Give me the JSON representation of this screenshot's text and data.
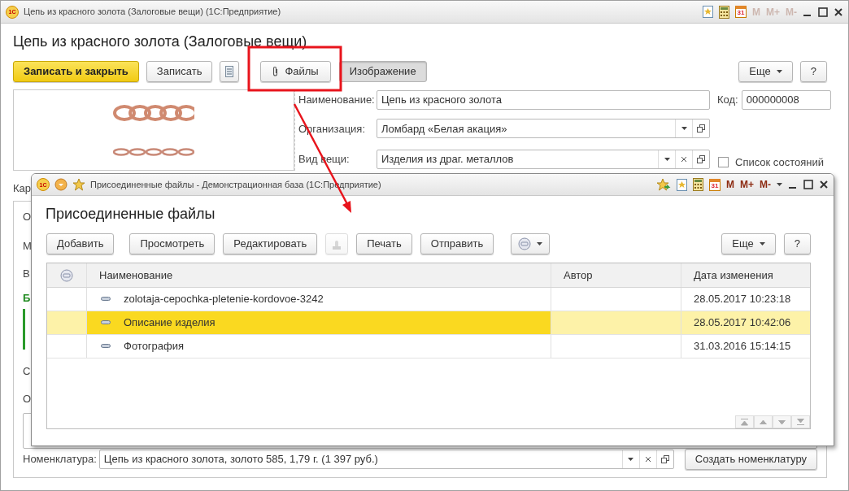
{
  "main_window": {
    "logo": "1С",
    "title": "Цепь из красного золота (Залоговые вещи)  (1С:Предприятие)",
    "titlebar_tools": {
      "calendar_day": "31",
      "memory_buttons": [
        "M",
        "M+",
        "M-"
      ],
      "memory_disabled": true
    },
    "form_title": "Цепь из красного золота (Залоговые вещи)",
    "toolbar": [
      {
        "kind": "primary",
        "label": "Записать и закрыть"
      },
      {
        "kind": "button",
        "label": "Записать"
      },
      {
        "kind": "list_icon"
      },
      {
        "kind": "attach",
        "label": "Файлы"
      },
      {
        "kind": "toggle",
        "label": "Изображение",
        "pressed": true
      }
    ],
    "more": "Еще",
    "help": "?",
    "fields": [
      {
        "kind": "text",
        "label": "Наименование:",
        "value": "Цепь из красного золота"
      },
      {
        "kind": "select",
        "label": "Организация:",
        "value": "Ломбард «Белая акация»"
      },
      {
        "kind": "select_clear",
        "label": "Вид вещи:",
        "value": "Изделия из драг. металлов"
      }
    ],
    "code": {
      "label": "Код:",
      "value": "000000008"
    },
    "checkbox": {
      "label": "Список состояний",
      "checked": false
    },
    "card_label": "Кар",
    "panel_items": [
      {
        "kind": "tab",
        "text": "О"
      },
      {
        "kind": "label",
        "text": "М"
      },
      {
        "kind": "label",
        "text": "В"
      },
      {
        "kind": "group",
        "text": "Б"
      },
      {
        "kind": "label",
        "text": "С"
      },
      {
        "kind": "label",
        "text": "О"
      },
      {
        "kind": "textarea"
      }
    ],
    "nomenclature": {
      "label": "Номенклатура:",
      "value": "Цепь из красного золота, золото 585, 1,79 г. (1 397 руб.)"
    },
    "create_button": "Создать номенклатуру"
  },
  "dialog": {
    "logo": "1С",
    "title": "Присоединенные файлы - Демонстрационная база  (1С:Предприятие)",
    "titlebar_tools": {
      "calendar_day": "31",
      "memory_buttons": [
        "M",
        "M+",
        "M-"
      ],
      "memory_disabled": false
    },
    "heading": "Присоединенные файлы",
    "toolbar": [
      {
        "kind": "button",
        "label": "Добавить"
      },
      {
        "kind": "button",
        "label": "Просмотреть"
      },
      {
        "kind": "button",
        "label": "Редактировать"
      },
      {
        "kind": "stamp",
        "disabled": true
      },
      {
        "kind": "button",
        "label": "Печать"
      },
      {
        "kind": "button",
        "label": "Отправить"
      },
      {
        "kind": "menu"
      }
    ],
    "more": "Еще",
    "help": "?",
    "table": {
      "columns": [
        "Наименование",
        "Автор",
        "Дата изменения"
      ],
      "rows": [
        {
          "name": "zolotaja-cepochka-pletenie-kordovoe-3242",
          "date": "28.05.2017 10:23:18",
          "selected": false
        },
        {
          "name": "Описание изделия",
          "date": "28.05.2017 10:42:06",
          "selected": true
        },
        {
          "name": "Фотография",
          "date": "31.03.2016 15:14:15",
          "selected": false
        }
      ]
    }
  }
}
